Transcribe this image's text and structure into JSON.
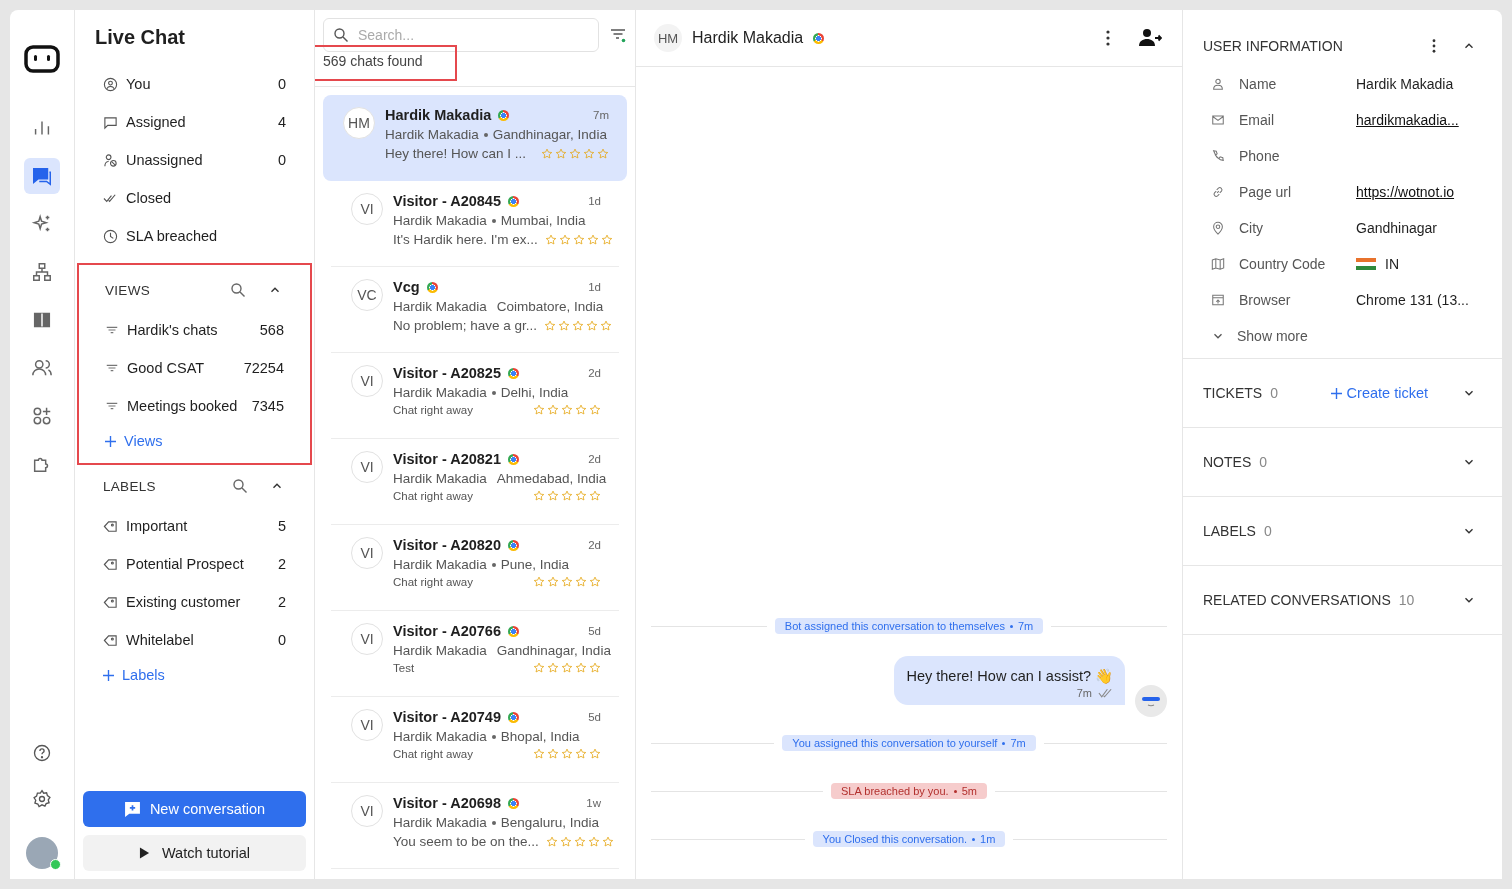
{
  "nav_rail": {
    "items": [
      {
        "selected": false
      },
      {
        "selected": true
      },
      {
        "selected": false
      },
      {
        "selected": false
      },
      {
        "selected": false
      },
      {
        "selected": false
      },
      {
        "selected": false
      },
      {
        "selected": false
      }
    ],
    "user_online": true
  },
  "sidebar": {
    "title": "Live Chat",
    "inbox": [
      {
        "label": "You",
        "count": "0"
      },
      {
        "label": "Assigned",
        "count": "4"
      },
      {
        "label": "Unassigned",
        "count": "0"
      },
      {
        "label": "Closed"
      },
      {
        "label": "SLA breached"
      }
    ],
    "views": {
      "heading": "VIEWS",
      "highlighted": true,
      "items": [
        {
          "label": "Hardik's chats",
          "count": "568"
        },
        {
          "label": "Good CSAT",
          "count": "72254"
        },
        {
          "label": "Meetings booked",
          "count": "7345"
        }
      ],
      "add": "Views"
    },
    "labels": {
      "heading": "LABELS",
      "items": [
        {
          "label": "Important",
          "count": "5"
        },
        {
          "label": "Potential Prospect",
          "count": "2"
        },
        {
          "label": "Existing customer",
          "count": "2"
        },
        {
          "label": "Whitelabel",
          "count": "0"
        }
      ],
      "add": "Labels"
    },
    "new_button": "New conversation",
    "tutorial_button": "Watch tutorial"
  },
  "chat_list": {
    "search": {
      "placeholder": "Search..."
    },
    "count": "569 chats found",
    "count_highlighted": true,
    "chats": [
      {
        "initials": "HM",
        "name": "Hardik Makadia",
        "time": "7m",
        "agent": "Hardik Makadia",
        "location": "Gandhinagar, India",
        "preview": "Hey there! How can I ...",
        "preview_small": false,
        "stars": 0,
        "selected": true
      },
      {
        "initials": "VI",
        "name": "Visitor - A20845",
        "time": "1d",
        "agent": "Hardik Makadia",
        "location": "Mumbai, India",
        "preview": "It's Hardik here. I'm ex...",
        "preview_small": false,
        "stars": 0,
        "selected": false
      },
      {
        "initials": "VC",
        "name": "Vcg",
        "time": "1d",
        "agent": "Hardik Makadia",
        "location": "Coimbatore, India",
        "preview": "No problem; have a gr...",
        "preview_small": false,
        "stars": 0,
        "selected": false
      },
      {
        "initials": "VI",
        "name": "Visitor - A20825",
        "time": "2d",
        "agent": "Hardik Makadia",
        "location": "Delhi, India",
        "preview": "Chat right away",
        "preview_small": true,
        "stars": 0,
        "selected": false
      },
      {
        "initials": "VI",
        "name": "Visitor - A20821",
        "time": "2d",
        "agent": "Hardik Makadia",
        "location": "Ahmedabad, India",
        "preview": "Chat right away",
        "preview_small": true,
        "stars": 0,
        "selected": false
      },
      {
        "initials": "VI",
        "name": "Visitor - A20820",
        "time": "2d",
        "agent": "Hardik Makadia",
        "location": "Pune, India",
        "preview": "Chat right away",
        "preview_small": true,
        "stars": 0,
        "selected": false
      },
      {
        "initials": "VI",
        "name": "Visitor - A20766",
        "time": "5d",
        "agent": "Hardik Makadia",
        "location": "Gandhinagar, India",
        "preview": "Test",
        "preview_small": true,
        "stars": 0,
        "selected": false
      },
      {
        "initials": "VI",
        "name": "Visitor - A20749",
        "time": "5d",
        "agent": "Hardik Makadia",
        "location": "Bhopal, India",
        "preview": "Chat right away",
        "preview_small": true,
        "stars": 0,
        "selected": false
      },
      {
        "initials": "VI",
        "name": "Visitor - A20698",
        "time": "1w",
        "agent": "Hardik Makadia",
        "location": "Bengaluru, India",
        "preview": "You seem to be on the...",
        "preview_small": false,
        "stars": 0,
        "selected": false
      }
    ]
  },
  "conversation": {
    "initials": "HM",
    "name": "Hardik Makadia",
    "messages": [
      {
        "kind": "event",
        "text": "Bot assigned this conversation to themselves",
        "time": "7m"
      },
      {
        "kind": "message",
        "text": "Hey there! How can I assist? 👋",
        "time": "7m"
      },
      {
        "kind": "event",
        "text": "You assigned this conversation to yourself",
        "time": "7m"
      },
      {
        "kind": "alert",
        "text": "SLA breached by you.",
        "time": "5m"
      },
      {
        "kind": "event",
        "text": "You Closed this conversation.",
        "time": "1m"
      }
    ]
  },
  "user_info": {
    "heading": "USER INFORMATION",
    "fields": [
      {
        "label": "Name",
        "value": "Hardik Makadia",
        "link": false
      },
      {
        "label": "Email",
        "value": "hardikmakadia...",
        "link": true
      },
      {
        "label": "Phone"
      },
      {
        "label": "Page url",
        "value": "https://wotnot.io",
        "link": true
      },
      {
        "label": "City",
        "value": "Gandhinagar",
        "link": false
      },
      {
        "label": "Country Code",
        "value": "IN",
        "link": false,
        "flag": true
      },
      {
        "label": "Browser",
        "value": "Chrome 131 (13...",
        "link": false
      }
    ],
    "show_more": "Show more",
    "sections": [
      {
        "title": "TICKETS",
        "count": "0",
        "action": "Create ticket"
      },
      {
        "title": "NOTES",
        "count": "0"
      },
      {
        "title": "LABELS",
        "count": "0"
      },
      {
        "title": "RELATED CONVERSATIONS",
        "count": "10"
      }
    ]
  }
}
